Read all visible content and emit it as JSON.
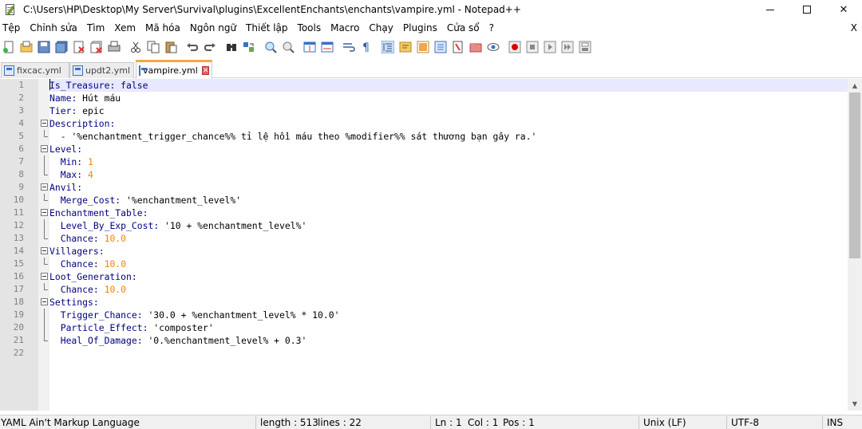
{
  "window": {
    "title": "C:\\Users\\HP\\Desktop\\My Server\\Survival\\plugins\\ExcellentEnchants\\enchants\\vampire.yml - Notepad++",
    "minimize": "—",
    "maximize": "☐",
    "close": "✕"
  },
  "menu": {
    "items": [
      "Tệp",
      "Chỉnh sửa",
      "Tìm",
      "Xem",
      "Mã hóa",
      "Ngôn ngữ",
      "Thiết lập",
      "Tools",
      "Macro",
      "Chạy",
      "Plugins",
      "Cửa sổ",
      "?"
    ],
    "close": "X"
  },
  "toolbar": {
    "icons": [
      "new-file-icon",
      "open-file-icon",
      "save-icon",
      "save-all-icon",
      "close-icon",
      "close-all-icon",
      "print-icon",
      "cut-icon",
      "copy-icon",
      "paste-icon",
      "undo-icon",
      "redo-icon",
      "find-icon",
      "replace-icon",
      "zoom-in-icon",
      "zoom-out-icon",
      "sync-vertical-icon",
      "sync-horizontal-icon",
      "word-wrap-icon",
      "show-all-chars-icon",
      "indent-guide-icon",
      "user-language-icon",
      "doc-map-icon",
      "function-list-icon",
      "folder-workspace-icon",
      "monitoring-icon",
      "record-macro-icon",
      "stop-macro-icon",
      "play-macro-icon",
      "run-macro-multiple-icon",
      "save-macro-icon"
    ]
  },
  "tabs": [
    {
      "label": "fixcac.yml",
      "active": false
    },
    {
      "label": "updt2.yml",
      "active": false
    },
    {
      "label": "vampire.yml",
      "active": true
    }
  ],
  "editor": {
    "current_line": 1,
    "lines": [
      {
        "n": "1",
        "key": "Is_Treasure",
        "sep": ": ",
        "val": "false",
        "val_type": "keyword",
        "indent": ""
      },
      {
        "n": "2",
        "key": "Name",
        "sep": ": ",
        "val": "Hút máu",
        "val_type": "text",
        "indent": ""
      },
      {
        "n": "3",
        "key": "Tier",
        "sep": ": ",
        "val": "epic",
        "val_type": "text",
        "indent": ""
      },
      {
        "n": "4",
        "key": "Description",
        "sep": ":",
        "val": "",
        "val_type": "text",
        "indent": "",
        "fold": true
      },
      {
        "n": "5",
        "key": "",
        "sep": "- ",
        "val": "'%enchantment_trigger_chance%% tỉ lệ hồi máu theo %modifier%% sát thương bạn gây ra.'",
        "val_type": "text",
        "indent": "  "
      },
      {
        "n": "6",
        "key": "Level",
        "sep": ":",
        "val": "",
        "val_type": "text",
        "indent": "",
        "fold": true
      },
      {
        "n": "7",
        "key": "Min",
        "sep": ": ",
        "val": "1",
        "val_type": "number",
        "indent": "  "
      },
      {
        "n": "8",
        "key": "Max",
        "sep": ": ",
        "val": "4",
        "val_type": "number",
        "indent": "  "
      },
      {
        "n": "9",
        "key": "Anvil",
        "sep": ":",
        "val": "",
        "val_type": "text",
        "indent": "",
        "fold": true
      },
      {
        "n": "10",
        "key": "Merge_Cost",
        "sep": ": ",
        "val": "'%enchantment_level%'",
        "val_type": "text",
        "indent": "  "
      },
      {
        "n": "11",
        "key": "Enchantment_Table",
        "sep": ":",
        "val": "",
        "val_type": "text",
        "indent": "",
        "fold": true
      },
      {
        "n": "12",
        "key": "Level_By_Exp_Cost",
        "sep": ": ",
        "val": "'10 + %enchantment_level%'",
        "val_type": "text",
        "indent": "  "
      },
      {
        "n": "13",
        "key": "Chance",
        "sep": ": ",
        "val": "10.0",
        "val_type": "number",
        "indent": "  "
      },
      {
        "n": "14",
        "key": "Villagers",
        "sep": ":",
        "val": "",
        "val_type": "text",
        "indent": "",
        "fold": true
      },
      {
        "n": "15",
        "key": "Chance",
        "sep": ": ",
        "val": "10.0",
        "val_type": "number",
        "indent": "  "
      },
      {
        "n": "16",
        "key": "Loot_Generation",
        "sep": ":",
        "val": "",
        "val_type": "text",
        "indent": "",
        "fold": true
      },
      {
        "n": "17",
        "key": "Chance",
        "sep": ": ",
        "val": "10.0",
        "val_type": "number",
        "indent": "  "
      },
      {
        "n": "18",
        "key": "Settings",
        "sep": ":",
        "val": "",
        "val_type": "text",
        "indent": "",
        "fold": true
      },
      {
        "n": "19",
        "key": "Trigger_Chance",
        "sep": ": ",
        "val": "'30.0 + %enchantment_level% * 10.0'",
        "val_type": "text",
        "indent": "  "
      },
      {
        "n": "20",
        "key": "Particle_Effect",
        "sep": ": ",
        "val": "'composter'",
        "val_type": "text",
        "indent": "  "
      },
      {
        "n": "21",
        "key": "Heal_Of_Damage",
        "sep": ": ",
        "val": "'0.%enchantment_level% + 0.3'",
        "val_type": "text",
        "indent": "  "
      },
      {
        "n": "22",
        "key": "",
        "sep": "",
        "val": "",
        "val_type": "text",
        "indent": ""
      }
    ]
  },
  "status": {
    "language": "YAML Ain't Markup Language",
    "length": "length : 513",
    "lines": "lines : 22",
    "ln": "Ln : 1",
    "col": "Col : 1",
    "pos": "Pos : 1",
    "eol": "Unix (LF)",
    "encoding": "UTF-8",
    "mode": "INS"
  },
  "colors": {
    "key": "#000080",
    "number": "#ff8000",
    "current_line": "#e8e8ff",
    "tab_accent": "#f4a940"
  }
}
